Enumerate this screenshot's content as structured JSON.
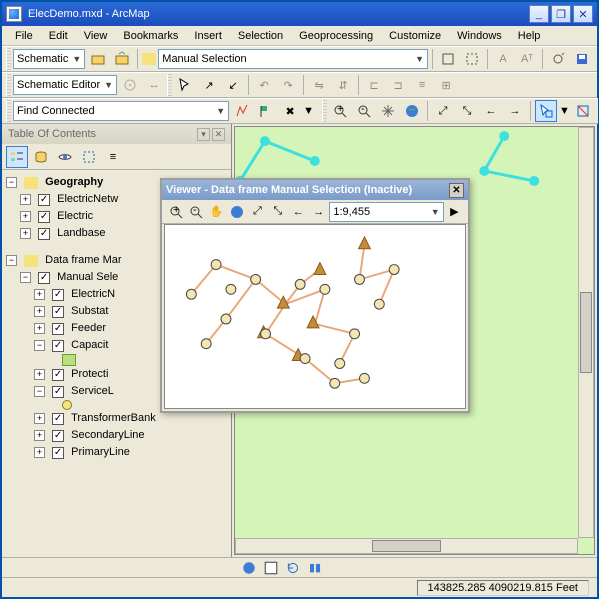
{
  "app": {
    "title": "ElecDemo.mxd - ArcMap"
  },
  "menu": {
    "file": "File",
    "edit": "Edit",
    "view": "View",
    "bookmarks": "Bookmarks",
    "insert": "Insert",
    "selection": "Selection",
    "geoprocessing": "Geoprocessing",
    "customize": "Customize",
    "windows": "Windows",
    "help": "Help"
  },
  "tb1": {
    "schematic": "Schematic",
    "layer": "Manual Selection"
  },
  "tb2": {
    "editor": "Schematic Editor"
  },
  "tb3": {
    "trace": "Find Connected"
  },
  "toc": {
    "title": "Table Of Contents",
    "root1": "Geography",
    "r1c": [
      "ElectricNetw",
      "Electric",
      "Landbase"
    ],
    "root2": "Data frame Mar",
    "r2a": "Manual Sele",
    "r2b": [
      "ElectricN",
      "Substat",
      "Feeder",
      "Capacit",
      "Protecti",
      "ServiceL",
      "TransformerBank",
      "SecondaryLine",
      "PrimaryLine"
    ]
  },
  "viewer": {
    "title": "Viewer - Data frame Manual Selection (Inactive)",
    "scale": "1:9,455"
  },
  "status": {
    "coords": "143825.285  4090219.815 Feet"
  },
  "chart_data": {
    "type": "map",
    "layers": [
      {
        "name": "ElectricNetwork",
        "geometry": "point-line",
        "color": "#3de0e0"
      },
      {
        "name": "TransformerBank",
        "geometry": "triangle",
        "color": "#c48b3a"
      },
      {
        "name": "ServiceLocation",
        "geometry": "circle",
        "color": "#f4e6b0"
      },
      {
        "name": "PrimaryLine",
        "geometry": "line",
        "color": "#e8a878"
      }
    ],
    "viewer_scale": "1:9455",
    "coordinates": {
      "x": 143825.285,
      "y": 4090219.815,
      "unit": "Feet"
    }
  }
}
